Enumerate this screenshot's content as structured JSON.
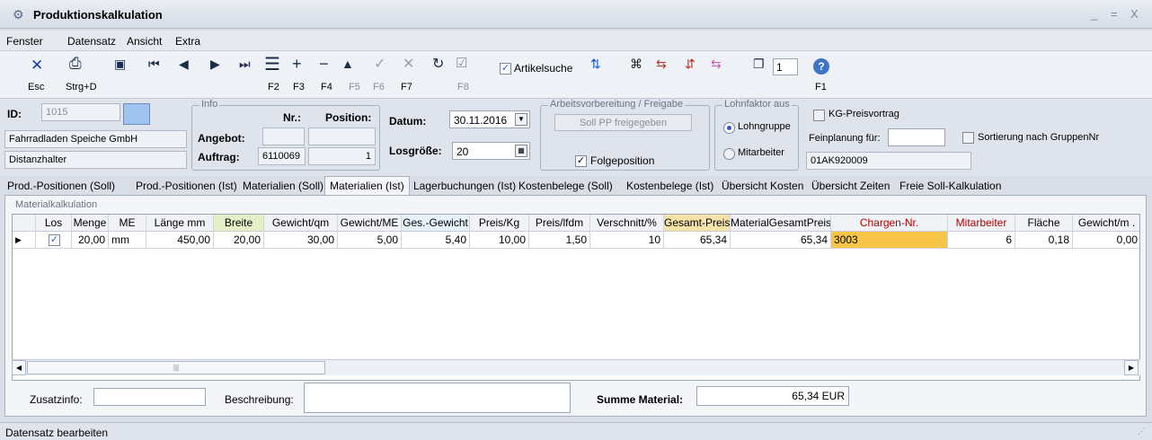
{
  "window": {
    "title": "Produktionskalkulation",
    "controls": [
      "_",
      "=",
      "X"
    ]
  },
  "menu": [
    "Fenster",
    "Datensatz",
    "Ansicht",
    "Extra"
  ],
  "toolbar": {
    "esc": "Esc",
    "strg_d": "Strg+D",
    "f2": "F2",
    "f3": "F3",
    "f4": "F4",
    "f5": "F5",
    "f6": "F6",
    "f7": "F7",
    "f8": "F8",
    "f1": "F1",
    "artikelsuche": "Artikelsuche",
    "page_value": "1"
  },
  "info": {
    "id_label": "ID:",
    "id_value": "1015",
    "customer": "Fahrradladen Speiche GmbH",
    "article": "Distanzhalter",
    "info_group": "Info",
    "nr_label": "Nr.:",
    "position_label": "Position:",
    "angebot_label": "Angebot:",
    "auftrag_label": "Auftrag:",
    "auftrag_nr": "6110069",
    "auftrag_pos": "1",
    "datum_label": "Datum:",
    "datum_value": "30.11.2016",
    "losgroesse_label": "Losgröße:",
    "losgroesse_value": "20",
    "av_group": "Arbeitsvorbereitung / Freigabe",
    "soll_pp_button": "Soll PP freigegeben",
    "folgeposition": "Folgeposition",
    "lohn_group": "Lohnfaktor aus",
    "lohngruppe": "Lohngruppe",
    "mitarbeiter": "Mitarbeiter",
    "kg_preisvortrag": "KG-Preisvortrag",
    "feinplanung_label": "Feinplanung für:",
    "feinplanung_code": "01AK920009",
    "sortierung": "Sortierung nach GruppenNr"
  },
  "tabs": [
    "Prod.-Positionen (Soll)",
    "Prod.-Positionen (Ist)",
    "Materialien (Soll)",
    "Materialien (Ist)",
    "Lagerbuchungen (Ist)",
    "Kostenbelege (Soll)",
    "Kostenbelege (Ist)",
    "Übersicht Kosten",
    "Übersicht Zeiten",
    "Freie Soll-Kalkulation"
  ],
  "section_title": "Materialkalkulation",
  "grid": {
    "headers": [
      "Los",
      "Menge",
      "ME",
      "Länge mm",
      "Breite",
      "Gewicht/qm",
      "Gewicht/ME",
      "Ges.-Gewicht",
      "Preis/Kg",
      "Preis/lfdm",
      "Verschnitt/%",
      "Gesamt-Preis",
      "MaterialGesamtPreis",
      "Chargen-Nr.",
      "Mitarbeiter",
      "Fläche",
      "Gewicht/m ."
    ],
    "row": [
      "",
      "20,00",
      "mm",
      "450,00",
      "20,00",
      "30,00",
      "5,00",
      "5,40",
      "10,00",
      "1,50",
      "10",
      "65,34",
      "65,34",
      "3003",
      "6",
      "0,18",
      "0,00"
    ]
  },
  "footer": {
    "zusatzinfo_label": "Zusatzinfo:",
    "beschreibung_label": "Beschreibung:",
    "summe_label": "Summe Material:",
    "summe_value": "65,34 EUR"
  },
  "status": "Datensatz bearbeiten",
  "colors": {
    "gesamt_header": "#f7e2a8",
    "breite_header": "#e6f0c8",
    "chargen_cell": "#f8c646",
    "red_header": "#b00000"
  }
}
